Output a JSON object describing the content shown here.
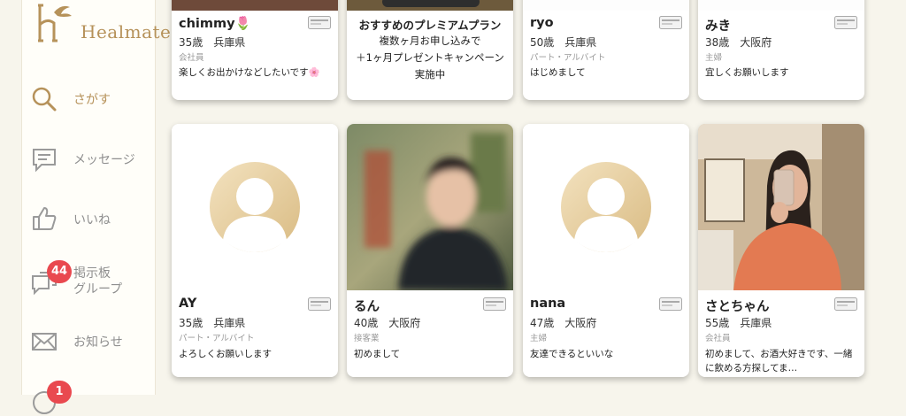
{
  "app": {
    "logo_text": "Healmate",
    "colors": {
      "accent": "#b6925a",
      "badge": "#e9494f",
      "background": "#f7f5ec"
    }
  },
  "sidebar": {
    "items": [
      {
        "label": "さがす",
        "icon": "search-icon",
        "active": true
      },
      {
        "label": "メッセージ",
        "icon": "message-icon"
      },
      {
        "label": "いいね",
        "icon": "thumbs-up-icon"
      },
      {
        "label": "掲示板\nグループ",
        "label_line1": "掲示板",
        "label_line2": "グループ",
        "icon": "board-icon",
        "badge": "44"
      },
      {
        "label": "お知らせ",
        "icon": "mail-icon"
      },
      {
        "icon": "chat-icon",
        "badge": "1"
      }
    ]
  },
  "profiles_top": [
    {
      "name": "chimmy🌷",
      "age_location": "35歳　兵庫県",
      "job": "会社員",
      "message": "楽しくお出かけなどしたいです🌸"
    },
    {
      "promo": true,
      "title": "おすすめのプレミアムプラン",
      "body": "複数ヶ月お申し込みで\n＋1ヶ月プレゼントキャンペーン実施中"
    },
    {
      "name": "ryo",
      "age_location": "50歳　兵庫県",
      "job": "パート・アルバイト",
      "message": "はじめまして"
    },
    {
      "name": "みき",
      "age_location": "38歳　大阪府",
      "job": "主婦",
      "message": "宜しくお願いします"
    }
  ],
  "profiles_bottom": [
    {
      "name": "AY",
      "age_location": "35歳　兵庫県",
      "job": "パート・アルバイト",
      "message": "よろしくお願いします",
      "photo": "placeholder"
    },
    {
      "name": "るん",
      "age_location": "40歳　大阪府",
      "job": "接客業",
      "message": "初めまして",
      "photo": "blurred"
    },
    {
      "name": "nana",
      "age_location": "47歳　大阪府",
      "job": "主婦",
      "message": "友達できるといいな",
      "photo": "placeholder"
    },
    {
      "name": "さとちゃん",
      "age_location": "55歳　兵庫県",
      "job": "会社員",
      "message": "初めまして、お酒大好きです、一緒に飲める方探してま…",
      "photo": "selfie"
    }
  ]
}
